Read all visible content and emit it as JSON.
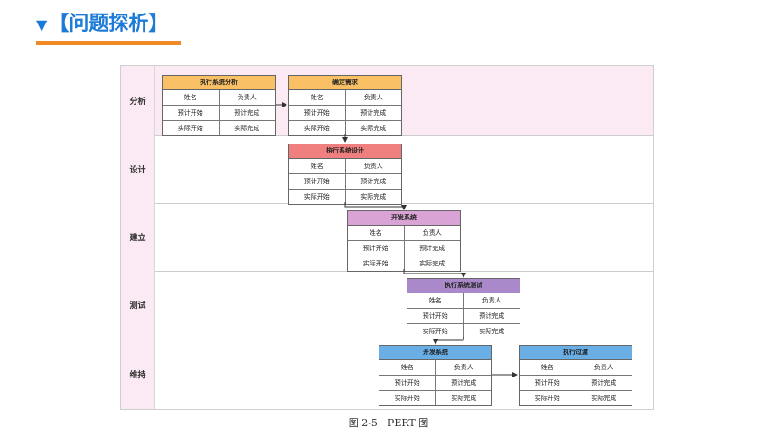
{
  "header": {
    "title": "【问题探析】",
    "triangle": "▼"
  },
  "lanes": [
    {
      "label": "分析",
      "color": "#fbeaf3"
    },
    {
      "label": "设计",
      "color": "#fbeaf3"
    },
    {
      "label": "建立",
      "color": "#fbeaf3"
    },
    {
      "label": "测试",
      "color": "#fbeaf3"
    },
    {
      "label": "维持",
      "color": "#fbeaf3"
    }
  ],
  "row_labels": {
    "name": "姓名",
    "owner": "负责人",
    "plan_start": "预计开始",
    "plan_end": "预计完成",
    "act_start": "实际开始",
    "act_end": "实际完成"
  },
  "nodes": [
    {
      "title": "执行系统分析",
      "color": "#f9c065"
    },
    {
      "title": "确定需求",
      "color": "#f9c065"
    },
    {
      "title": "执行系统设计",
      "color": "#f08080"
    },
    {
      "title": "开发系统",
      "color": "#d9a3d6"
    },
    {
      "title": "执行系统测试",
      "color": "#a989c9"
    },
    {
      "title": "开发系统",
      "color": "#6aaee6"
    },
    {
      "title": "执行过渡",
      "color": "#6aaee6"
    }
  ],
  "caption": "图 2-5　PERT 图"
}
